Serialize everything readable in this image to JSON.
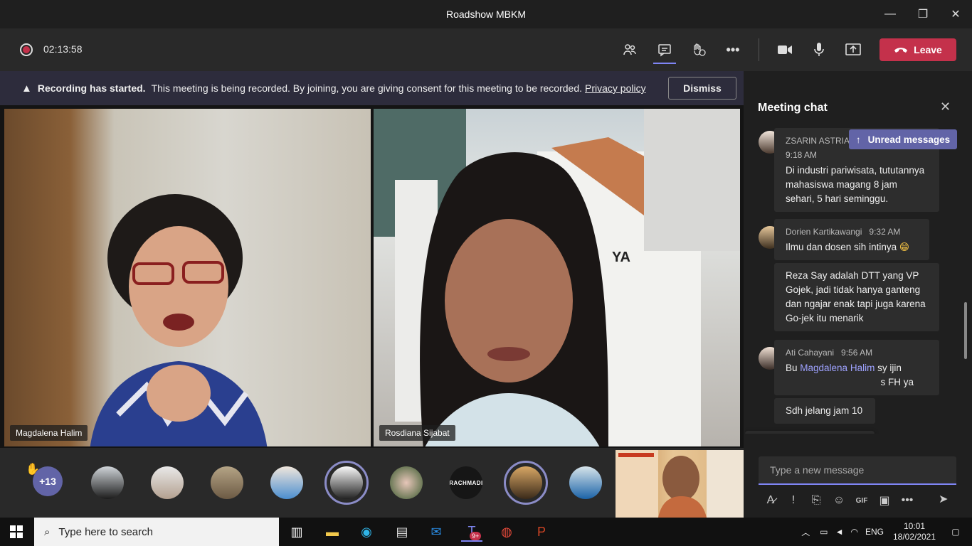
{
  "window": {
    "title": "Roadshow MBKM",
    "minimize": "—",
    "maximize": "❐",
    "close": "✕"
  },
  "toolbar": {
    "timer": "02:13:58",
    "leave_label": "Leave"
  },
  "banner": {
    "bold": "Recording has started.",
    "text": "This meeting is being recorded. By joining, you are giving consent for this meeting to be recorded.",
    "link": "Privacy policy",
    "dismiss": "Dismiss"
  },
  "videos": [
    {
      "name": "Magdalena Halim"
    },
    {
      "name": "Rosdiana Sijabat"
    }
  ],
  "strip": {
    "more_count": "+13",
    "avatar_text": "RACHMADI"
  },
  "chat": {
    "title": "Meeting chat",
    "unread": "Unread messages",
    "messages": [
      {
        "author": "ZSARIN ASTRIA F",
        "time": "9:18 AM",
        "text": "Di industri pariwisata, tututannya mahasiswa magang 8 jam sehari, 5 hari seminggu."
      },
      {
        "author": "Dorien Kartikawangi",
        "time": "9:32 AM",
        "text": "Ilmu dan dosen sih intinya"
      },
      {
        "author": "",
        "time": "",
        "text": "Reza Say adalah DTT yang VP Gojek, jadi tidak hanya ganteng dan ngajar enak tapi juga karena Go-jek itu menarik"
      },
      {
        "author": "Ati Cahayani",
        "time": "9:56 AM",
        "text_pre": "Bu ",
        "mention": "Magdalena Halim",
        "text_post": " sy ijin",
        "text2": "s FH ya"
      },
      {
        "author": "",
        "time": "",
        "text": "Sdh jelang jam 10"
      }
    ],
    "compose_placeholder": "Type a new message",
    "reactions": [
      "👍",
      "❤",
      "😄",
      "😮",
      "😟",
      "😡",
      "•••"
    ]
  },
  "taskbar": {
    "search_placeholder": "Type here to search",
    "teams_badge": "9+",
    "lang": "ENG",
    "time": "10:01",
    "date": "18/02/2021"
  },
  "colors": {
    "accent": "#6264a7",
    "leave": "#c4314b",
    "banner": "#2d2c3c"
  }
}
